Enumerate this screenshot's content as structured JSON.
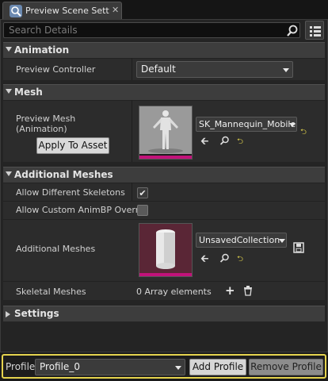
{
  "tab": {
    "title": "Preview Scene Sett",
    "close": "✕"
  },
  "search": {
    "placeholder": "Search Details"
  },
  "categories": {
    "animation": "Animation",
    "mesh": "Mesh",
    "additional": "Additional Meshes",
    "settings": "Settings"
  },
  "animation": {
    "preview_controller_label": "Preview Controller",
    "preview_controller_value": "Default"
  },
  "mesh": {
    "preview_mesh_label_1": "Preview Mesh",
    "preview_mesh_label_2": "(Animation)",
    "apply_button": "Apply To Asset",
    "asset_value": "SK_Mannequin_Mobile"
  },
  "additional": {
    "allow_skeletons_label": "Allow Different Skeletons",
    "allow_skeletons_checked": true,
    "allow_animbp_label": "Allow Custom AnimBP Overri",
    "allow_animbp_checked": false,
    "meshes_label": "Additional Meshes",
    "collection_value": "UnsavedCollection",
    "skeletal_label": "Skeletal Meshes",
    "array_value": "0 Array elements"
  },
  "profile": {
    "label": "Profile",
    "value": "Profile_0",
    "add_button": "Add Profile",
    "remove_button": "Remove Profile"
  },
  "colors": {
    "accent_magenta": "#c2127a",
    "highlight_yellow": "#e5d34e"
  },
  "icons": [
    "details-tab-icon",
    "search-icon",
    "view-options-icon",
    "back-arrow-icon",
    "browse-icon",
    "reset-icon",
    "add-icon",
    "delete-icon",
    "save-icon"
  ]
}
